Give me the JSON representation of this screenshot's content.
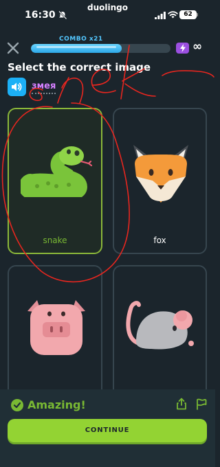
{
  "status_bar": {
    "time": "16:30",
    "app_name": "duolingo",
    "battery": "62",
    "icons": [
      "mute-icon",
      "signal-icon",
      "wifi-icon",
      "battery-icon"
    ]
  },
  "top_bar": {
    "combo_label": "COMBO x21",
    "progress": 0.65,
    "hearts": "∞",
    "icons": [
      "close-icon",
      "bolt-icon",
      "infinity-icon"
    ]
  },
  "prompt": {
    "title": "Select the correct image",
    "word": "змея"
  },
  "cards": [
    {
      "label": "snake",
      "selected": true,
      "icon": "snake-icon"
    },
    {
      "label": "fox",
      "selected": false,
      "icon": "fox-icon"
    },
    {
      "label": "",
      "selected": false,
      "icon": "pig-icon"
    },
    {
      "label": "",
      "selected": false,
      "icon": "mouse-icon"
    }
  ],
  "annotation": {
    "handwritten_text": "snek",
    "color": "#e8261f"
  },
  "feedback": {
    "message": "Amazing!",
    "continue_label": "CONTINUE",
    "icons": [
      "check-circle-icon",
      "share-icon",
      "flag-icon"
    ]
  },
  "colors": {
    "background": "#1b252c",
    "accent_blue": "#1cb0f6",
    "success_green": "#79b933",
    "button_green": "#93d333",
    "word_purple": "#d580ff"
  }
}
